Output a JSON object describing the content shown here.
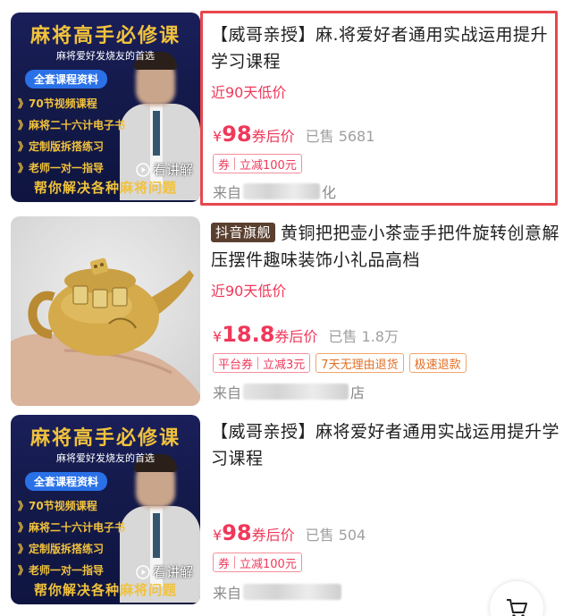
{
  "items": [
    {
      "title": "【威哥亲授】麻.将爱好者通用实战运用提升学习课程",
      "low_price_label": "近90天低价",
      "yen": "¥",
      "price": "98",
      "price_suffix": "券后价",
      "sold": "已售 5681",
      "tags": [
        {
          "a": "券",
          "b": "立减100元"
        }
      ],
      "source_prefix": "来自",
      "source_tail": "化",
      "thumb": {
        "title": "麻将高手必修课",
        "subtitle": "麻将爱好发烧友的首选",
        "pill": "全套课程资料",
        "list": [
          "》70节视频课程",
          "》麻将二十六计电子书",
          "》定制版拆搭练习",
          "》老师一对一指导"
        ],
        "bottom": "帮你解决各种麻将问题",
        "watch_label": "看讲解"
      }
    },
    {
      "shop_tag": "抖音旗舰",
      "title": "黄铜把把壶小茶壶手把件旋转创意解压摆件趣味装饰小礼品高档",
      "low_price_label": "近90天低价",
      "yen": "¥",
      "price": "18.8",
      "price_suffix": "券后价",
      "sold": "已售 1.8万",
      "tags": [
        {
          "a": "平台券",
          "b": "立减3元"
        },
        {
          "a": "7天无理由退货"
        },
        {
          "a": "极速退款"
        }
      ],
      "source_prefix": "来自",
      "source_tail": "店"
    },
    {
      "title": "【威哥亲授】麻将爱好者通用实战运用提升学习课程",
      "yen": "¥",
      "price": "98",
      "price_suffix": "券后价",
      "sold": "已售 504",
      "tags": [
        {
          "a": "券",
          "b": "立减100元"
        }
      ],
      "source_prefix": "来自",
      "thumb": {
        "title": "麻将高手必修课",
        "subtitle": "麻将爱好发烧友的首选",
        "pill": "全套课程资料",
        "list": [
          "》70节视频课程",
          "》麻将二十六计电子书",
          "》定制版拆搭练习",
          "》老师一对一指导"
        ],
        "bottom": "帮你解决各种麻将问题",
        "watch_label": "看讲解"
      }
    }
  ],
  "colors": {
    "accent": "#f0385a",
    "highlight": "#e8474d",
    "shop_tag_bg": "#5b4030"
  },
  "icons": {
    "watch": "play-icon",
    "cart": "cart-icon"
  }
}
